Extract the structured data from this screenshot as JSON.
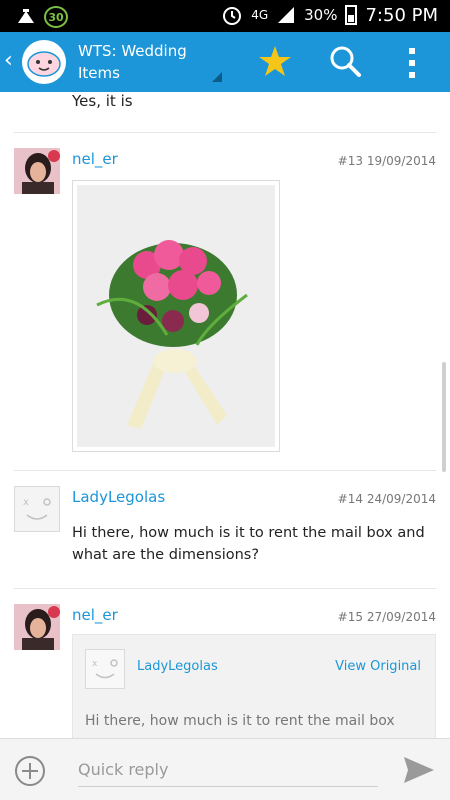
{
  "status_bar": {
    "notification_count": "30",
    "network": "4G",
    "battery": "30%",
    "time": "7:50 PM"
  },
  "action_bar": {
    "title": "WTS: Wedding Items"
  },
  "thread": {
    "previous_post_tail": "Yes, it is",
    "posts": [
      {
        "author": "nel_er",
        "number": "#13",
        "date": "19/09/2014"
      },
      {
        "author": "LadyLegolas",
        "number": "#14",
        "date": "24/09/2014",
        "text": "Hi there, how much is it to rent the mail box and what are the dimensions?"
      },
      {
        "author": "nel_er",
        "number": "#15",
        "date": "27/09/2014",
        "quote": {
          "author": "LadyLegolas",
          "view_original": "View Original",
          "text": "Hi there, how much is it to rent the mail box"
        }
      }
    ]
  },
  "reply_bar": {
    "placeholder": "Quick reply"
  },
  "colors": {
    "accent": "#1c96d8",
    "status_bar": "#000000",
    "star": "#f5c518"
  },
  "icons": {
    "back": "chevron-left-icon",
    "logo": "forum-logo-icon",
    "favorite": "star-icon",
    "search": "search-icon",
    "overflow": "more-vertical-icon",
    "add": "plus-circle-icon",
    "send": "send-icon"
  }
}
